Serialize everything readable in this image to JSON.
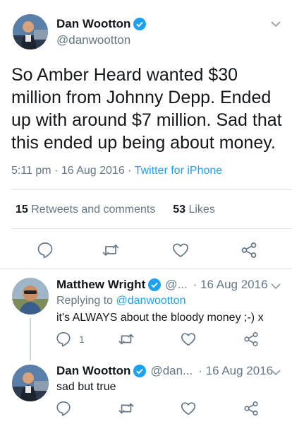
{
  "main_tweet": {
    "author_name": "Dan Wootton",
    "author_handle": "@danwootton",
    "text": "So Amber Heard wanted $30 million from Johnny Depp. Ended up with around $7 million. Sad that this ended up being about money.",
    "time": "5:11 pm",
    "date_sep": " · ",
    "date": "16 Aug 2016",
    "source_sep": " · ",
    "source": "Twitter for iPhone",
    "retweets_count": "15",
    "retweets_label": " Retweets and comments",
    "likes_count": "53",
    "likes_label": " Likes"
  },
  "replies": [
    {
      "author_name": "Matthew Wright",
      "author_handle": "@...",
      "date": "· 16 Aug 2016",
      "replying_prefix": "Replying to ",
      "replying_to": "@danwootton",
      "text": "it's ALWAYS about the bloody money ;-) x",
      "reply_count": "1"
    },
    {
      "author_name": "Dan Wootton",
      "author_handle": "@dan...",
      "date": "· 16 Aug 2016",
      "text": "sad but true"
    }
  ],
  "colors": {
    "link": "#1da1f2",
    "muted": "#657786",
    "verified": "#1da1f2"
  },
  "icons": [
    "reply-icon",
    "retweet-icon",
    "like-icon",
    "share-icon",
    "verified-icon",
    "chevron-down-icon"
  ]
}
